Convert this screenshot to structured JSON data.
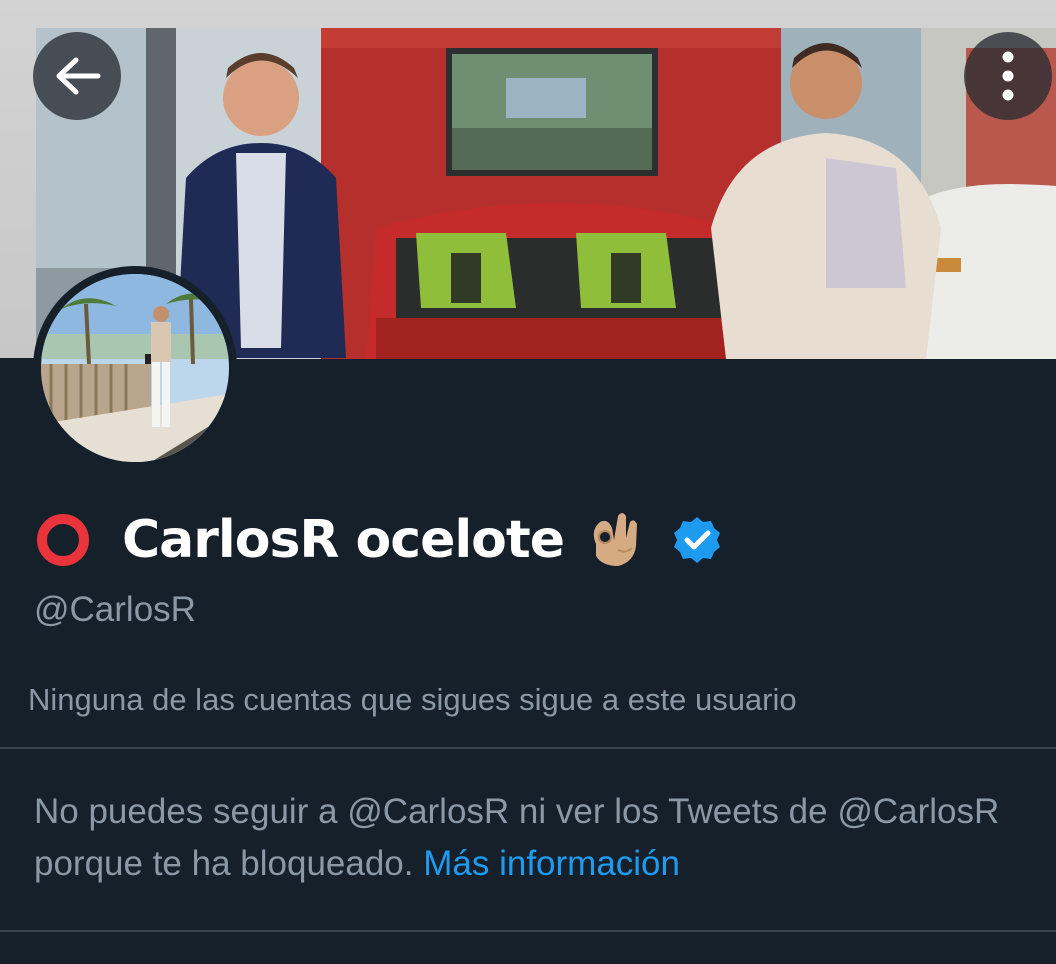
{
  "header": {
    "back_icon": "arrow-left-icon",
    "more_icon": "more-vertical-icon"
  },
  "profile": {
    "status_icon": "red-circle-icon",
    "display_name": "CarlosR ocelote",
    "name_emoji": "ok-hand-emoji",
    "verified_icon": "verified-badge-icon",
    "handle": "@CarlosR",
    "followers_note": "Ninguna de las cuentas que sigues sigue a este usuario"
  },
  "blocked": {
    "message": "No puedes seguir a @CarlosR ni ver los Tweets de @CarlosR porque te ha bloqueado.",
    "link_label": "Más información"
  },
  "colors": {
    "background": "#15202b",
    "secondary_text": "#8b98a5",
    "link": "#1d9bf0",
    "verified": "#1d9bf0",
    "status_ring": "#e8343a"
  }
}
